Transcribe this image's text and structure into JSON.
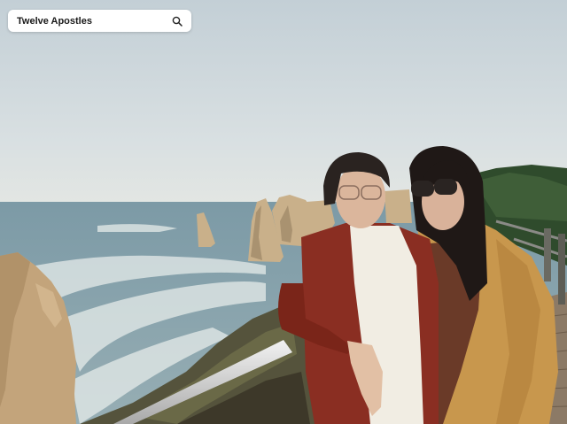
{
  "search": {
    "value": "Twelve Apostles",
    "placeholder": ""
  },
  "icons": {
    "search": "search-icon"
  },
  "colors": {
    "search_bg": "#ffffff",
    "text": "#1a1a1a",
    "sky": "#c9d6dd",
    "ocean": "#7d9eac",
    "cliff": "#c6a77d",
    "red_coat": "#8a2e22",
    "tan_coat": "#c8974d"
  }
}
